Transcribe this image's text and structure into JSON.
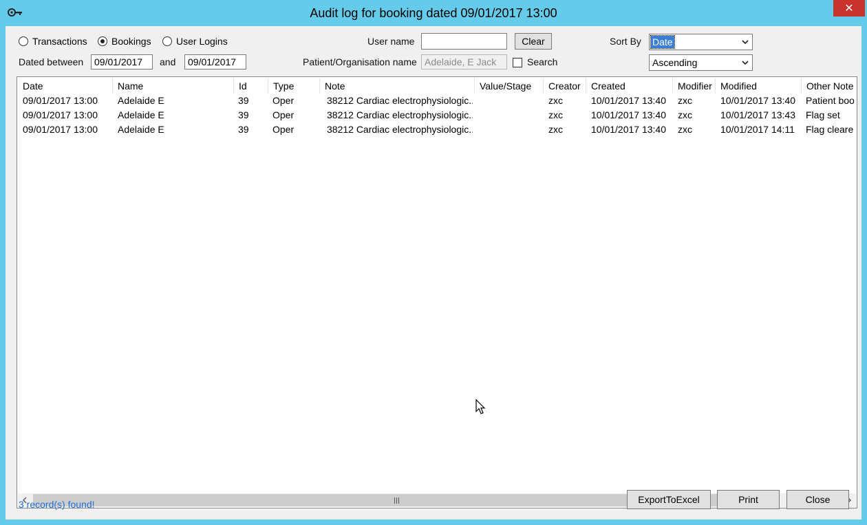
{
  "window": {
    "title": "Audit log for booking dated 09/01/2017 13:00",
    "close_glyph": "✕"
  },
  "filters": {
    "radios": [
      {
        "label": "Transactions",
        "checked": false
      },
      {
        "label": "Bookings",
        "checked": true
      },
      {
        "label": "User Logins",
        "checked": false
      }
    ],
    "dated_between_label": "Dated between",
    "date_from": "09/01/2017",
    "and_label": "and",
    "date_to": "09/01/2017",
    "user_name_label": "User name",
    "user_name_value": "",
    "clear_label": "Clear",
    "patient_label": "Patient/Organisation name",
    "patient_value": "Adelaide, E Jack",
    "search_label": "Search",
    "search_checked": false,
    "sort_by_label": "Sort By",
    "sort_by_value": "Date",
    "order_value": "Ascending"
  },
  "table": {
    "columns": [
      "Date",
      "Name",
      "Id",
      "Type",
      "Note",
      "Value/Stage",
      "Creator",
      "Created",
      "Modifier",
      "Modified",
      "Other Note"
    ],
    "rows": [
      [
        "09/01/2017 13:00",
        "Adelaide E",
        "39",
        "Oper",
        "38212 Cardiac electrophysiologic...",
        "",
        "zxc",
        "10/01/2017 13:40",
        "zxc",
        "10/01/2017 13:40",
        "Patient boo"
      ],
      [
        "09/01/2017 13:00",
        "Adelaide E",
        "39",
        "Oper",
        "38212 Cardiac electrophysiologic...",
        "",
        "zxc",
        "10/01/2017 13:40",
        "zxc",
        "10/01/2017 13:43",
        "Flag set"
      ],
      [
        "09/01/2017 13:00",
        "Adelaide E",
        "39",
        "Oper",
        "38212 Cardiac electrophysiologic...",
        "",
        "zxc",
        "10/01/2017 13:40",
        "zxc",
        "10/01/2017 14:11",
        "Flag cleare"
      ]
    ]
  },
  "footer": {
    "status": "3 record(s) found!",
    "export_label": "ExportToExcel",
    "print_label": "Print",
    "close_label": "Close"
  },
  "colors": {
    "titlebar": "#65cbea",
    "close_button": "#c7332a",
    "status_text": "#1f6fd4",
    "selection": "#3a7fd5"
  }
}
